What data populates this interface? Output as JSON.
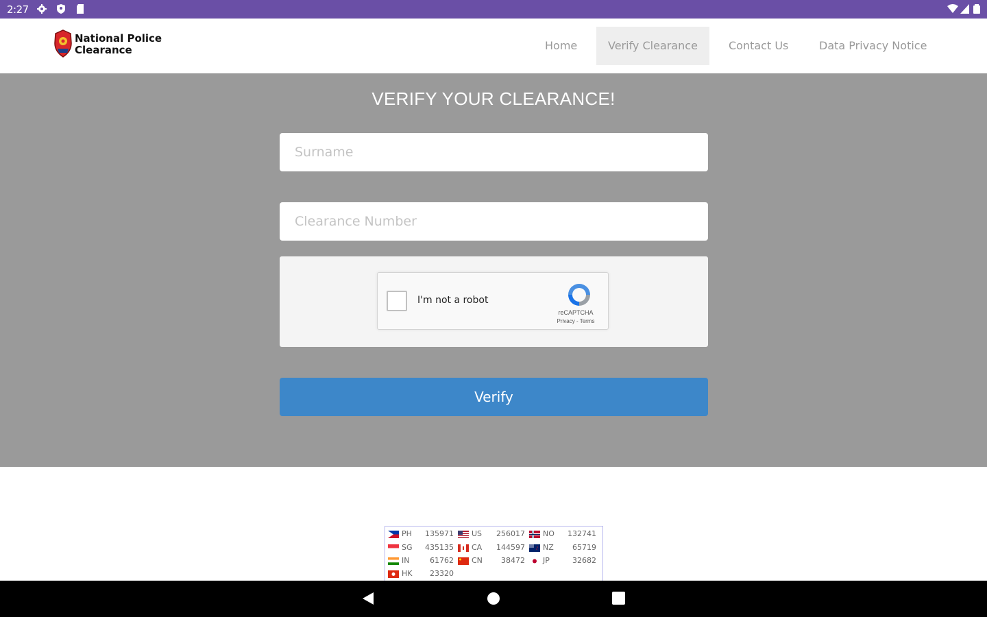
{
  "status_bar": {
    "time": "2:27",
    "left_icons": [
      "gear-icon",
      "shield-icon",
      "sd-card-icon"
    ],
    "right_icons": [
      "wifi-icon",
      "signal-icon",
      "battery-icon"
    ],
    "color": "#6a4fa6"
  },
  "header": {
    "logo_line1": "National Police",
    "logo_line2": "Clearance",
    "nav": [
      {
        "label": "Home",
        "active": false
      },
      {
        "label": "Verify Clearance",
        "active": true
      },
      {
        "label": "Contact Us",
        "active": false
      },
      {
        "label": "Data Privacy Notice",
        "active": false
      }
    ]
  },
  "main": {
    "title": "VERIFY YOUR CLEARANCE!",
    "surname_placeholder": "Surname",
    "clearance_placeholder": "Clearance Number",
    "captcha": {
      "label": "I'm not a robot",
      "brand": "reCAPTCHA",
      "links": "Privacy - Terms"
    },
    "verify_label": "Verify",
    "verify_color": "#3d87c9"
  },
  "flag_counter": {
    "rows": [
      [
        {
          "code": "PH",
          "count": "135971"
        },
        {
          "code": "US",
          "count": "256017"
        },
        {
          "code": "NO",
          "count": "132741"
        }
      ],
      [
        {
          "code": "SG",
          "count": "435135"
        },
        {
          "code": "CA",
          "count": "144597"
        },
        {
          "code": "NZ",
          "count": "65719"
        }
      ],
      [
        {
          "code": "IN",
          "count": "61762"
        },
        {
          "code": "CN",
          "count": "38472"
        },
        {
          "code": "JP",
          "count": "32682"
        }
      ],
      [
        {
          "code": "HK",
          "count": "23320"
        }
      ]
    ]
  },
  "nav_bar": {
    "buttons": [
      "back-icon",
      "home-icon",
      "recents-icon"
    ]
  }
}
